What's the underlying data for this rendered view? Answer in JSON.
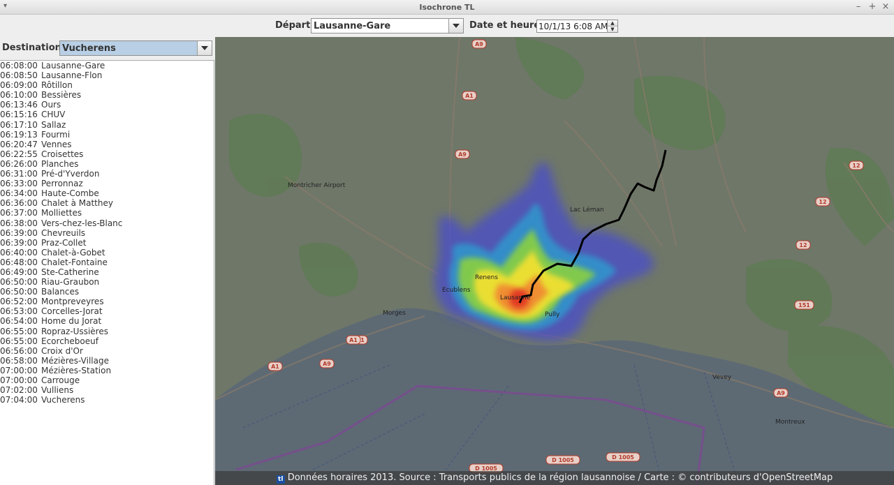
{
  "window": {
    "title": "Isochrone TL",
    "menu_glyph": "▾",
    "minimize": "–",
    "maximize": "+",
    "close": "×"
  },
  "top": {
    "depart_label": "Départ",
    "depart_value": "Lausanne-Gare",
    "datetime_label": "Date et heure",
    "datetime_value": "10/1/13 6:08 AM"
  },
  "destination": {
    "label": "Destination",
    "value": "Vucherens"
  },
  "stops": [
    {
      "time": "06:08:00",
      "name": "Lausanne-Gare"
    },
    {
      "time": "06:08:50",
      "name": "Lausanne-Flon"
    },
    {
      "time": "06:09:00",
      "name": "Rôtillon"
    },
    {
      "time": "06:10:00",
      "name": "Bessières"
    },
    {
      "time": "06:13:46",
      "name": "Ours"
    },
    {
      "time": "06:15:16",
      "name": "CHUV"
    },
    {
      "time": "06:17:10",
      "name": "Sallaz"
    },
    {
      "time": "06:19:13",
      "name": "Fourmi"
    },
    {
      "time": "06:20:47",
      "name": "Vennes"
    },
    {
      "time": "06:22:55",
      "name": "Croisettes"
    },
    {
      "time": "06:26:00",
      "name": "Planches"
    },
    {
      "time": "06:31:00",
      "name": "Pré-d'Yverdon"
    },
    {
      "time": "06:33:00",
      "name": "Perronnaz"
    },
    {
      "time": "06:34:00",
      "name": "Haute-Combe"
    },
    {
      "time": "06:36:00",
      "name": "Chalet à Matthey"
    },
    {
      "time": "06:37:00",
      "name": "Molliettes"
    },
    {
      "time": "06:38:00",
      "name": "Vers-chez-les-Blanc"
    },
    {
      "time": "06:39:00",
      "name": "Chevreuils"
    },
    {
      "time": "06:39:00",
      "name": "Praz-Collet"
    },
    {
      "time": "06:40:00",
      "name": "Chalet-à-Gobet"
    },
    {
      "time": "06:48:00",
      "name": "Chalet-Fontaine"
    },
    {
      "time": "06:49:00",
      "name": "Ste-Catherine"
    },
    {
      "time": "06:50:00",
      "name": "Riau-Graubon"
    },
    {
      "time": "06:50:00",
      "name": "Balances"
    },
    {
      "time": "06:52:00",
      "name": "Montpreveyres"
    },
    {
      "time": "06:53:00",
      "name": "Corcelles-Jorat"
    },
    {
      "time": "06:54:00",
      "name": "Home du Jorat"
    },
    {
      "time": "06:55:00",
      "name": "Ropraz-Ussières"
    },
    {
      "time": "06:55:00",
      "name": "Ecorcheboeuf"
    },
    {
      "time": "06:56:00",
      "name": "Croix d'Or"
    },
    {
      "time": "06:58:00",
      "name": "Mézières-Village"
    },
    {
      "time": "07:00:00",
      "name": "Mézières-Station"
    },
    {
      "time": "07:00:00",
      "name": "Carrouge"
    },
    {
      "time": "07:02:00",
      "name": "Vulliens"
    },
    {
      "time": "07:04:00",
      "name": "Vucherens"
    }
  ],
  "map": {
    "places": {
      "lausanne": "Lausanne",
      "renens": "Renens",
      "ecublens": "Ecublens",
      "pully": "Pully",
      "morges": "Morges",
      "vevey": "Vevey",
      "montreux": "Montreux",
      "lac": "Lac Léman",
      "airport": "Montricher Airport"
    },
    "routes": [
      "A9",
      "A1",
      "A9",
      "A1",
      "A9",
      "A1",
      "A1",
      "A9",
      "D 1005",
      "D 1005",
      "D 1005",
      "151",
      "12",
      "12",
      "12"
    ],
    "footer_logo": "tl",
    "footer": "Données horaires 2013. Source : Transports publics de la région lausannoise / Carte : © contributeurs d'OpenStreetMap",
    "colors": {
      "lake": "#5d6a74",
      "land": "#6f7769",
      "route": "#000000",
      "heat_center": "#e03020"
    }
  }
}
